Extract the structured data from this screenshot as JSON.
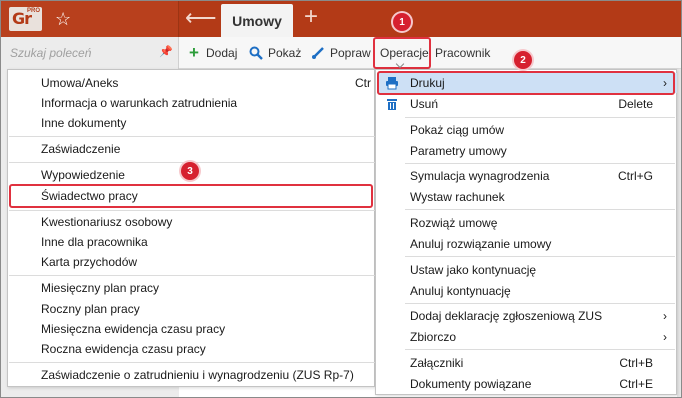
{
  "app": {
    "logo_text": "Gr",
    "logo_badge": "PRO",
    "active_tab": "Umowy"
  },
  "search": {
    "placeholder": "Szukaj poleceń"
  },
  "toolbar": {
    "add": "Dodaj",
    "show": "Pokaż",
    "edit": "Popraw",
    "operations": "Operacje",
    "employee": "Pracownik"
  },
  "submenu": {
    "items": [
      {
        "label": "Umowa/Aneks",
        "shortcut": "Ctr"
      },
      {
        "label": "Informacja o warunkach zatrudnienia"
      },
      {
        "label": "Inne dokumenty"
      },
      {
        "label": "Zaświadczenie"
      },
      {
        "label": "Wypowiedzenie"
      },
      {
        "label": "Świadectwo pracy"
      },
      {
        "label": "Kwestionariusz osobowy"
      },
      {
        "label": "Inne dla pracownika"
      },
      {
        "label": "Karta przychodów"
      },
      {
        "label": "Miesięczny plan pracy"
      },
      {
        "label": "Roczny plan pracy"
      },
      {
        "label": "Miesięczna ewidencja czasu pracy"
      },
      {
        "label": "Roczna ewidencja czasu pracy"
      },
      {
        "label": "Zaświadczenie o zatrudnieniu i wynagrodzeniu (ZUS Rp-7)"
      }
    ]
  },
  "dropdown": {
    "items": [
      {
        "label": "Drukuj",
        "icon": "printer-icon",
        "has_submenu": true
      },
      {
        "label": "Usuń",
        "icon": "trash-icon",
        "shortcut": "Delete"
      },
      {
        "label": "Pokaż ciąg umów"
      },
      {
        "label": "Parametry umowy"
      },
      {
        "label": "Symulacja wynagrodzenia",
        "shortcut": "Ctrl+G"
      },
      {
        "label": "Wystaw rachunek"
      },
      {
        "label": "Rozwiąż umowę"
      },
      {
        "label": "Anuluj rozwiązanie umowy"
      },
      {
        "label": "Ustaw jako kontynuację"
      },
      {
        "label": "Anuluj kontynuację"
      },
      {
        "label": "Dodaj deklarację zgłoszeniową ZUS",
        "has_submenu": true
      },
      {
        "label": "Zbiorczo",
        "has_submenu": true
      },
      {
        "label": "Załączniki",
        "shortcut": "Ctrl+B"
      },
      {
        "label": "Dokumenty powiązane",
        "shortcut": "Ctrl+E"
      }
    ]
  },
  "annotations": {
    "step1": "1",
    "step2": "2",
    "step3": "3"
  },
  "colors": {
    "brand": "#b33a17",
    "highlight_border": "#e0313f",
    "selection": "#cde0f5",
    "icon_blue": "#1e6fc4",
    "icon_green": "#2d9d3a"
  }
}
